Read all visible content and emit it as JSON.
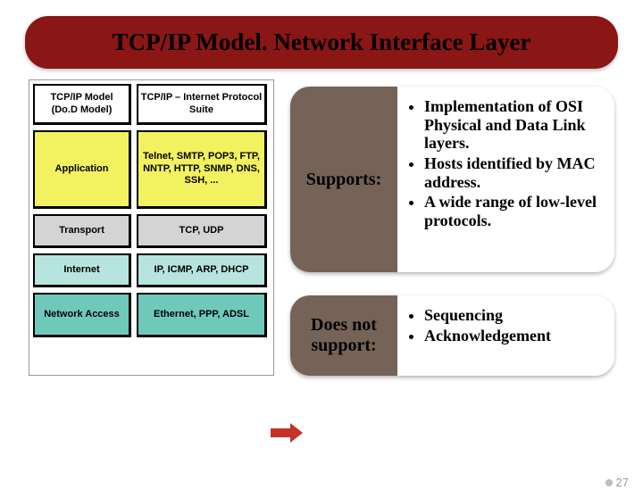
{
  "title": "TCP/IP Model. Network Interface Layer",
  "diagram": {
    "headers": [
      "TCP/IP Model (Do.D Model)",
      "TCP/IP – Internet Protocol Suite"
    ],
    "rows": [
      {
        "left": "Application",
        "right": "Telnet, SMTP, POP3, FTP, NNTP, HTTP, SNMP, DNS, SSH, ...",
        "cls": "app"
      },
      {
        "left": "Transport",
        "right": "TCP, UDP",
        "cls": "trans"
      },
      {
        "left": "Internet",
        "right": "IP, ICMP, ARP, DHCP",
        "cls": "inet"
      },
      {
        "left": "Network Access",
        "right": "Ethernet, PPP, ADSL",
        "cls": "net"
      }
    ]
  },
  "callouts": [
    {
      "label": "Supports:",
      "items": [
        "Implementation of OSI Physical and Data Link layers.",
        "Hosts identified by MAC address.",
        "A wide range of low-level protocols."
      ]
    },
    {
      "label": "Does not support:",
      "items": [
        "Sequencing",
        "Acknowledgement"
      ]
    }
  ],
  "page_number": "27"
}
